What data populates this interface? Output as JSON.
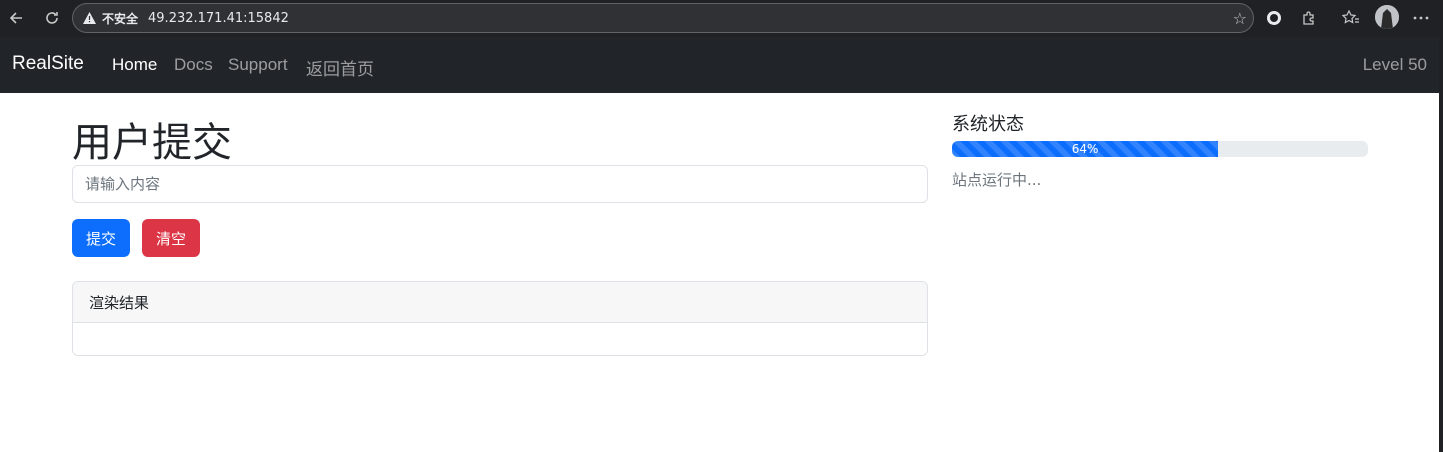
{
  "browser": {
    "security_label": "不安全",
    "url": "49.232.171.41:15842"
  },
  "navbar": {
    "brand": "RealSite",
    "links": [
      {
        "label": "Home",
        "active": true
      },
      {
        "label": "Docs",
        "active": false
      },
      {
        "label": "Support",
        "active": false
      },
      {
        "label": "返回首页",
        "active": false
      }
    ],
    "level": "Level 50"
  },
  "main": {
    "title": "用户提交",
    "input": {
      "value": "",
      "placeholder": "请输入内容"
    },
    "submit_label": "提交",
    "clear_label": "清空",
    "result_card": {
      "header": "渲染结果",
      "body": ""
    }
  },
  "sidebar": {
    "title": "系统状态",
    "progress": {
      "value": 64,
      "label": "64%"
    },
    "status": "站点运行中..."
  },
  "colors": {
    "primary": "#0d6efd",
    "danger": "#dc3545",
    "navbar": "#212529"
  }
}
